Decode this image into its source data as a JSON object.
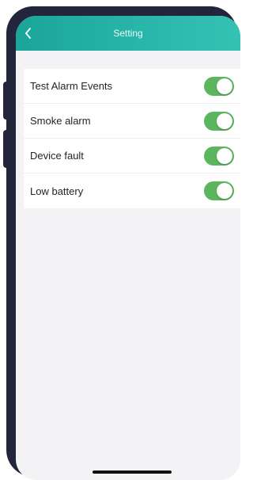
{
  "header": {
    "title": "Setting",
    "back_icon": "chevron-left-icon"
  },
  "settings": [
    {
      "label": "Test Alarm Events",
      "enabled": true
    },
    {
      "label": "Smoke alarm",
      "enabled": true
    },
    {
      "label": "Device fault",
      "enabled": true
    },
    {
      "label": "Low battery",
      "enabled": true
    }
  ],
  "colors": {
    "header": "#27b6a9",
    "toggle_on": "#5bb65d",
    "frame": "#23263a",
    "screen_bg": "#f3f3f5"
  }
}
